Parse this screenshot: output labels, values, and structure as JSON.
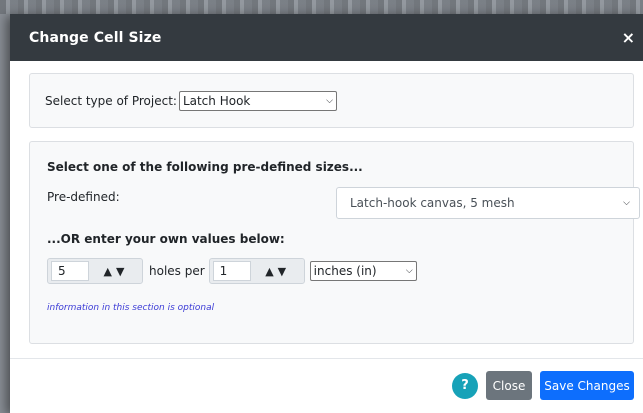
{
  "dialog": {
    "title": "Change Cell Size",
    "close_icon": "×"
  },
  "project": {
    "label": "Select type of Project:",
    "selected": "Latch Hook"
  },
  "predefined": {
    "heading": "Select one of the following pre-defined sizes...",
    "label": "Pre-defined:",
    "selected": "Latch-hook canvas, 5 mesh"
  },
  "custom": {
    "heading": "...OR enter your own values below:",
    "holes_value": "5",
    "holes_per_label": "holes per",
    "per_value": "1",
    "unit_selected": "inches (in)",
    "note": "information in this section is optional"
  },
  "footer": {
    "help_label": "?",
    "close_label": "Close",
    "save_label": "Save Changes"
  },
  "colors": {
    "header_bg": "#343a40",
    "save": "#0d6efd",
    "close": "#6c757d",
    "help": "#17a2b8"
  }
}
